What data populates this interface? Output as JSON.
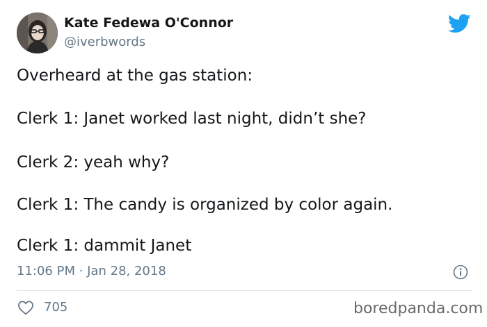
{
  "author": {
    "display_name": "Kate Fedewa O'Connor",
    "handle": "@iverbwords"
  },
  "icons": {
    "brand": "twitter-bird-icon",
    "info": "info-icon",
    "like": "heart-icon"
  },
  "tweet": {
    "lines": [
      "Overheard at the gas station:",
      "Clerk 1: Janet worked last night, didn’t she?",
      "Clerk 2: yeah why?",
      "Clerk 1: The candy is organized by color again.",
      "Clerk 1: dammit Janet"
    ],
    "timestamp": "11:06 PM · Jan 28, 2018",
    "likes": "705"
  },
  "watermark": "boredpanda.com",
  "colors": {
    "text": "#14171a",
    "secondary": "#657786",
    "twitter_blue": "#1da1f2",
    "divider": "#e1e8ed"
  }
}
